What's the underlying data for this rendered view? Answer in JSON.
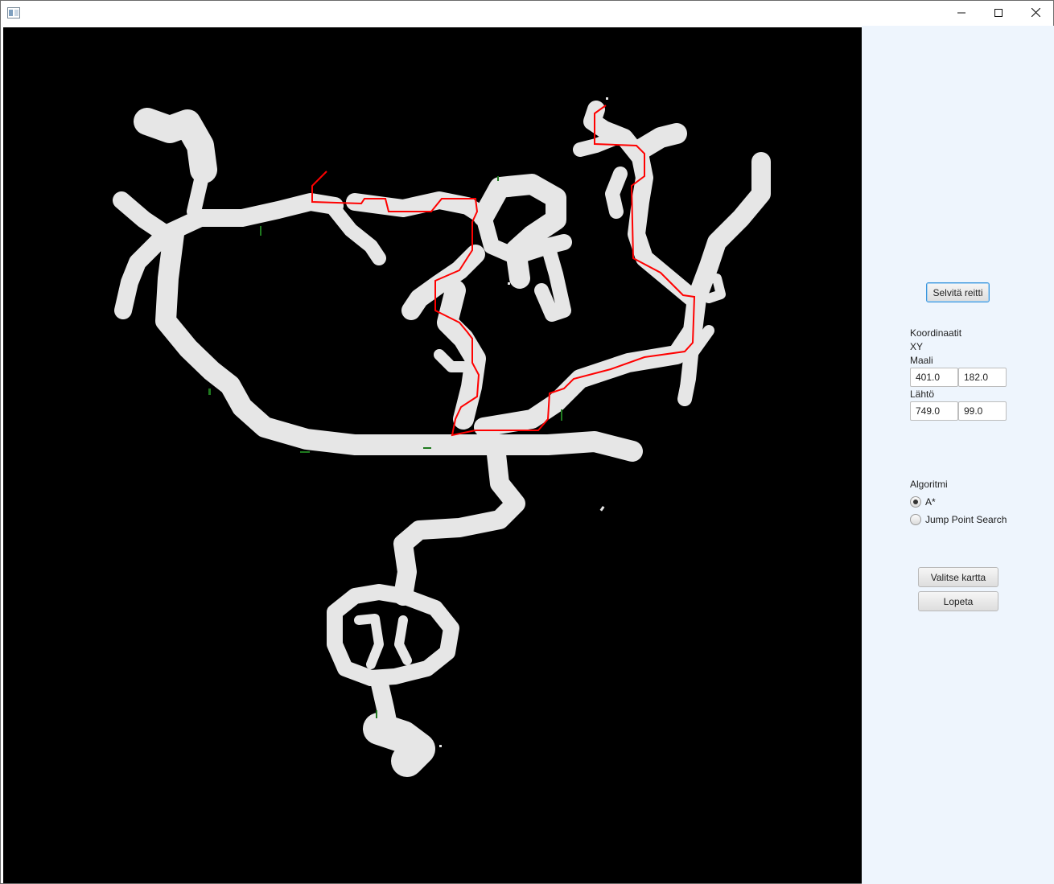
{
  "window": {
    "title": "",
    "controls": {
      "minimize_icon": "minimize-icon",
      "maximize_icon": "maximize-icon",
      "close_icon": "close-icon"
    }
  },
  "map": {
    "background_color": "#000000",
    "cave_color": "#e6e6e6",
    "path_color": "#ff0000",
    "visited_color": "#1f7a1f"
  },
  "panel": {
    "background_color": "#eef5fd",
    "solve_button": "Selvitä reitti",
    "coordinates_heading": "Koordinaatit",
    "xy_label": "XY",
    "goal_label": "Maali",
    "goal_x": "401.0",
    "goal_y": "182.0",
    "start_label": "Lähtö",
    "start_x": "749.0",
    "start_y": "99.0",
    "algorithm_heading": "Algoritmi",
    "algorithms": [
      {
        "label": "A*",
        "selected": true
      },
      {
        "label": "Jump Point Search",
        "selected": false
      }
    ],
    "choose_map_button": "Valitse kartta",
    "quit_button": "Lopeta"
  }
}
